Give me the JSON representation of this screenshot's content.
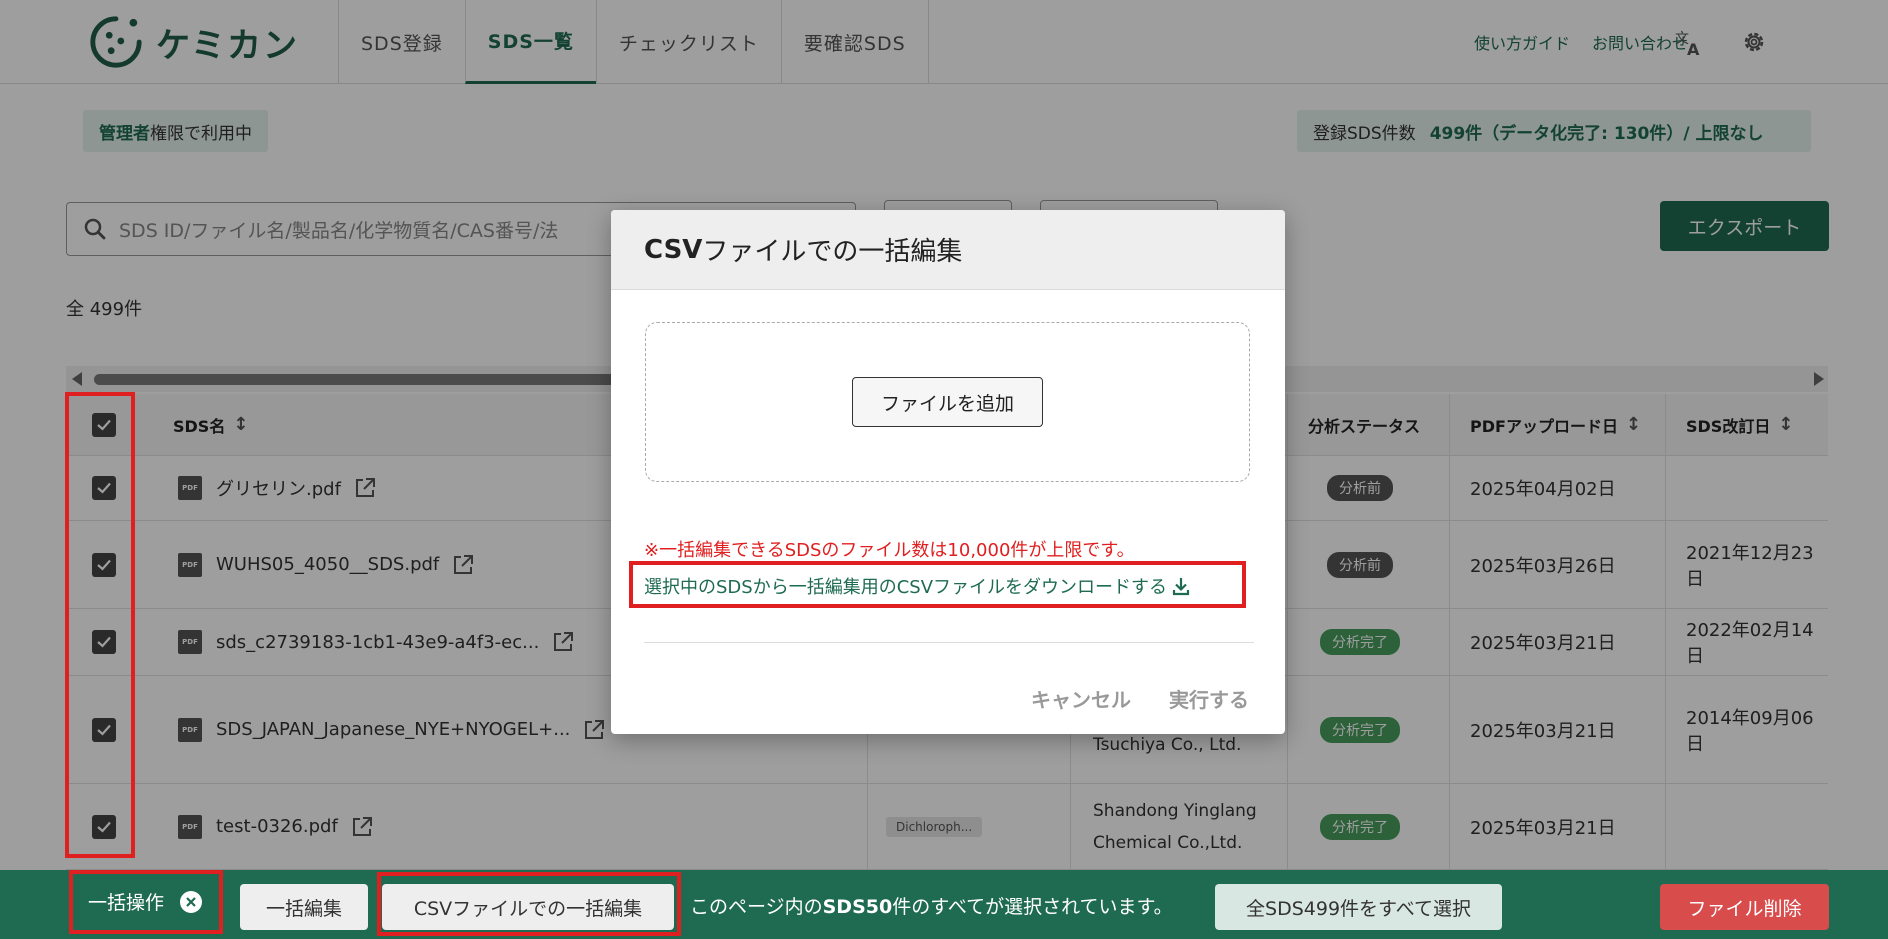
{
  "app": {
    "logo_text": "ケミカン",
    "logo_icon": "kemikan-logo-icon",
    "brand_color": "#1f6b52"
  },
  "nav": {
    "tabs": [
      {
        "label": "SDS登録",
        "active": false
      },
      {
        "label": "SDS一覧",
        "active": true
      },
      {
        "label": "チェックリスト",
        "active": false
      },
      {
        "label": "要確認SDS",
        "active": false
      }
    ]
  },
  "header": {
    "guide_link": "使い方ガイド",
    "contact_link": "お問い合わせ",
    "translate_icon": "translate-icon",
    "settings_icon": "gear-icon"
  },
  "role": {
    "prefix": "管理者",
    "suffix": "権限で利用中"
  },
  "counts": {
    "label": "登録SDS件数",
    "value": "499件（データ化完了: 130件）/ 上限なし"
  },
  "search": {
    "placeholder": "SDS ID/ファイル名/製品名/化学物質名/CAS番号/法"
  },
  "export_label": "エクスポート",
  "total_label": "全 499件",
  "table": {
    "columns": {
      "name": "SDS名",
      "status": "分析ステータス",
      "upload_date": "PDFアップロード日",
      "revision_date": "SDS改訂日"
    },
    "rows": [
      {
        "name": "グリセリン.pdf",
        "chip": "",
        "supplier_1": "",
        "supplier_2": "",
        "status": "分析前",
        "status_type": "before",
        "upload_date": "2025年04月02日",
        "revision_date": ""
      },
      {
        "name": "WUHS05_4050__SDS.pdf",
        "chip": "",
        "supplier_1": "",
        "supplier_2": "",
        "status": "分析前",
        "status_type": "before",
        "upload_date": "2025年03月26日",
        "revision_date": "2021年12月23日"
      },
      {
        "name": "sds_c2739183-1cb1-43e9-a4f3-ec...",
        "chip": "",
        "supplier_1": "",
        "supplier_2": "",
        "status": "分析完了",
        "status_type": "done",
        "upload_date": "2025年03月21日",
        "revision_date": "2022年02月14日"
      },
      {
        "name": "SDS_JAPAN_Japanese_NYE+NYOGEL+...",
        "chip": "",
        "supplier_1": "Tsuchiya Co., Ltd.",
        "supplier_2": "",
        "status": "分析完了",
        "status_type": "done",
        "upload_date": "2025年03月21日",
        "revision_date": "2014年09月06日"
      },
      {
        "name": "test-0326.pdf",
        "chip": "Dichloroph...",
        "supplier_1": "Shandong Yinglang",
        "supplier_2": "Chemical Co.,Ltd.",
        "status": "分析完了",
        "status_type": "done",
        "upload_date": "2025年03月21日",
        "revision_date": ""
      }
    ]
  },
  "modal": {
    "title_bold": "CSV",
    "title_rest": "ファイルでの一括編集",
    "add_file_label": "ファイルを追加",
    "note": "※一括編集できるSDSのファイル数は10,000件が上限です。",
    "download_link": "選択中のSDSから一括編集用のCSVファイルをダウンロードする",
    "download_icon": "download-icon",
    "cancel_label": "キャンセル",
    "execute_label": "実行する"
  },
  "bottom_bar": {
    "bulk_label": "一括操作",
    "close_icon": "close-icon",
    "bulk_edit_label": "一括編集",
    "csv_edit_label": "CSVファイルでの一括編集",
    "message_pre": "このページ内の",
    "message_bold": "SDS50",
    "message_post": "件のすべてが選択されています。",
    "select_all_label": "全SDS499件をすべて選択",
    "delete_label": "ファイル削除",
    "delete_color": "#d94c4c"
  }
}
